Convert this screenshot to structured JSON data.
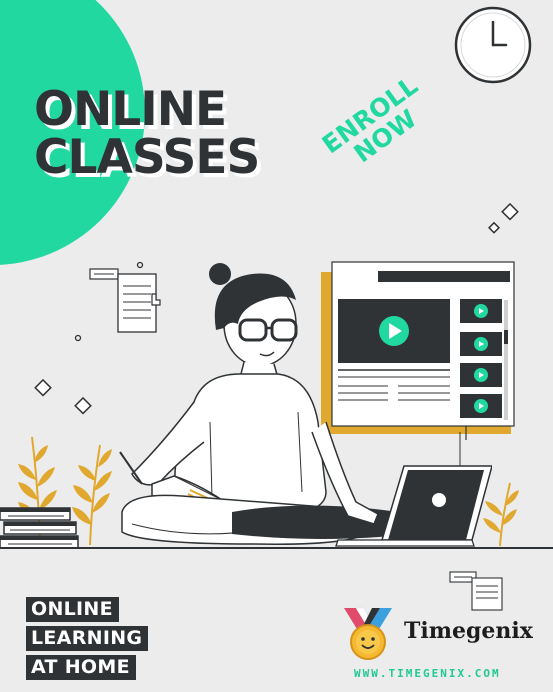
{
  "poster": {
    "title_line1": "ONLINE",
    "title_line2": "CLASSES",
    "enroll_line1": "ENROLL",
    "enroll_line2": "NOW",
    "tag_lines": [
      "ONLINE",
      "LEARNING",
      "AT HOME"
    ],
    "brand_name": "Timegenix",
    "brand_url": "WWW.TIMEGENIX.COM"
  },
  "icons": {
    "clock": "wall-clock-icon",
    "play": "play-icon",
    "medal": "medal-icon",
    "leaf": "leaf-icon",
    "books": "books-icon",
    "laptop": "laptop-icon",
    "cursor": "hand-cursor-icon"
  },
  "colors": {
    "accent": "#21d9a0",
    "dark": "#2f3336",
    "mustard": "#e0a82e",
    "background": "#ececec"
  }
}
